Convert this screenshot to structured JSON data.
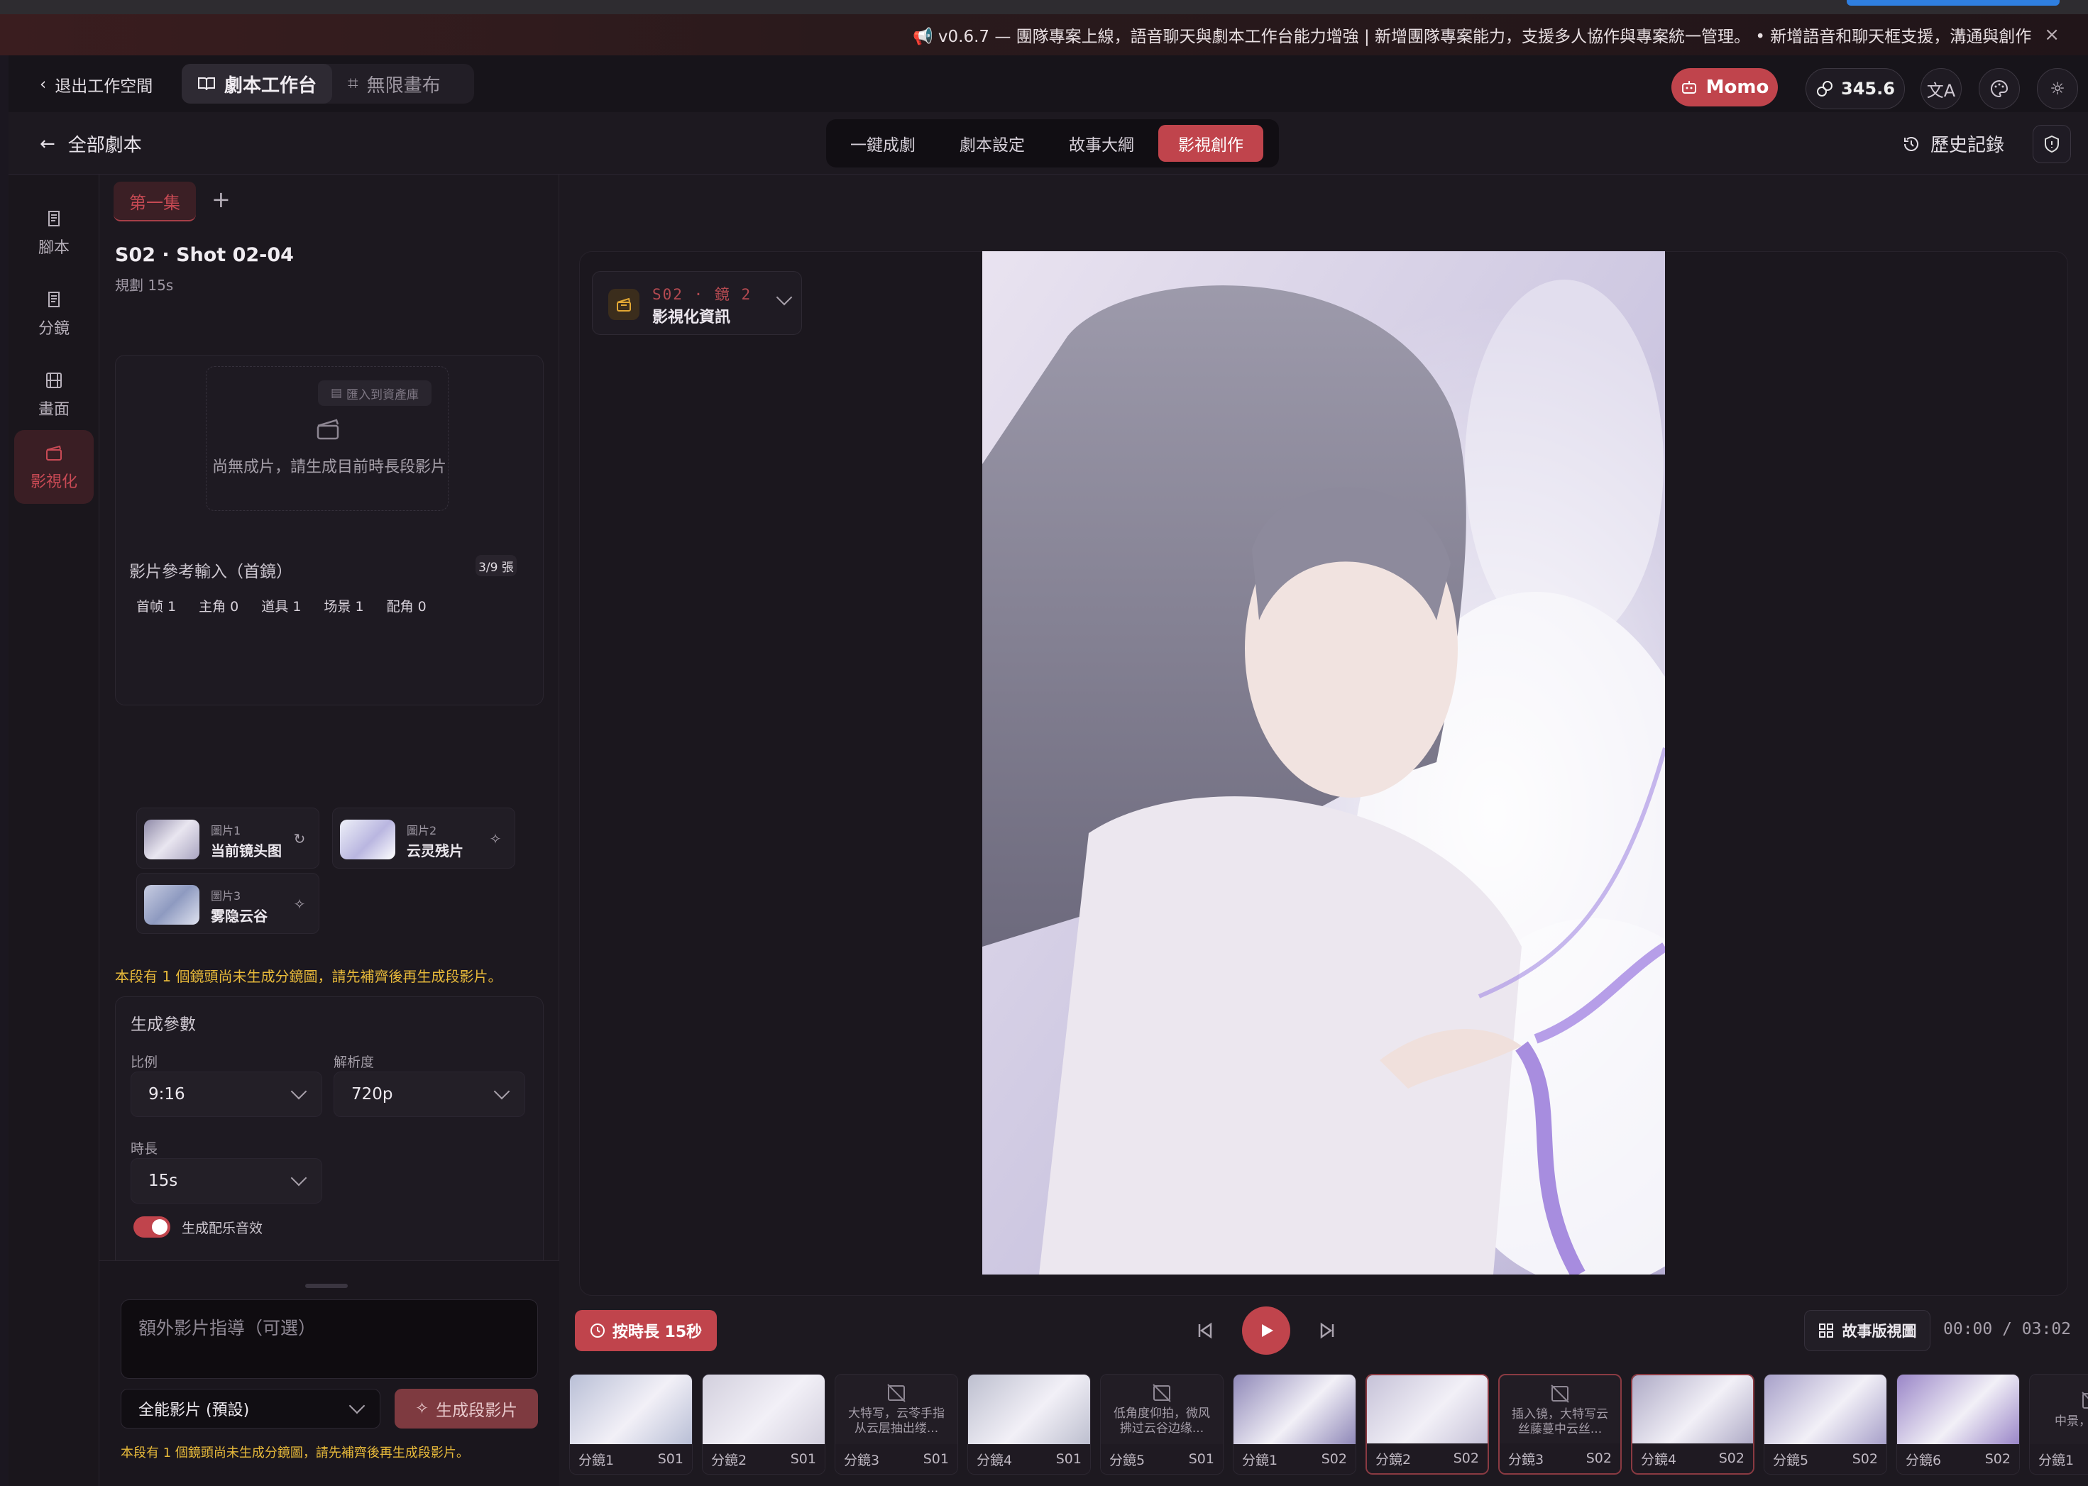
{
  "marquee": {
    "text": "📢 v0.6.7 — 團隊專案上線，語音聊天與劇本工作台能力增強 | 新增團隊專案能力，支援多人協作與專案統一管理。 • 新增語音和聊天框支援，溝通與創作",
    "close": "×"
  },
  "appbar": {
    "back": "退出工作空間",
    "tab_script": "劇本工作台",
    "tab_canvas": "無限畫布",
    "momo": "Momo",
    "credits": "345.6"
  },
  "subbar": {
    "back": "全部劇本",
    "modes": [
      "一鍵成劇",
      "劇本設定",
      "故事大綱",
      "影視創作"
    ],
    "active_mode": 3,
    "history": "歷史記錄"
  },
  "leftnav": {
    "items": [
      "腳本",
      "分鏡",
      "畫面",
      "影視化"
    ],
    "active": 3
  },
  "panel": {
    "episode": "第一集",
    "plus": "+",
    "shot_title": "S02 · Shot 02-04",
    "shot_plan": "規劃 15s",
    "import": "匯入到資產庫",
    "empty": "尚無成片，請生成目前時長段影片",
    "ref_title": "影片參考輸入（首鏡）",
    "ref_count": "3/9 張",
    "cats": [
      "首帧 1",
      "主角 0",
      "道具 1",
      "场景 1",
      "配角 0"
    ],
    "refs": [
      {
        "label": "圖片1",
        "name": "当前镜头图"
      },
      {
        "label": "圖片2",
        "name": "云灵残片"
      },
      {
        "label": "圖片3",
        "name": "雾隐云谷"
      }
    ],
    "warning": "本段有 1 個鏡頭尚未生成分鏡圖，請先補齊後再生成段影片。",
    "params_title": "生成參數",
    "ratio_label": "比例",
    "ratio": "9:16",
    "res_label": "解析度",
    "res": "720p",
    "dur_label": "時長",
    "dur": "15s",
    "music": "生成配乐音效",
    "music_on": true,
    "guide_placeholder": "額外影片指導（可選）",
    "model": "全能影片 (預設)",
    "gen": "生成段影片",
    "warning2": "本段有 1 個鏡頭尚未生成分鏡圖，請先補齊後再生成段影片。"
  },
  "main": {
    "shot_code": "S02 · 鏡 2",
    "shot_name": "影視化資訊",
    "dur_button": "按時長 15秒",
    "story_view": "故事版視圖",
    "timecode": "00:00 / 03:02"
  },
  "filmstrip": [
    {
      "label": "分鏡1",
      "scene": "S01",
      "type": "img",
      "tint": "#b9bfd6"
    },
    {
      "label": "分鏡2",
      "scene": "S01",
      "type": "img",
      "tint": "#d2cfdd"
    },
    {
      "label": "分鏡3",
      "scene": "S01",
      "type": "ph",
      "text": "大特写，云苓手指从云层抽出缕..."
    },
    {
      "label": "分鏡4",
      "scene": "S01",
      "type": "img",
      "tint": "#bdbfcf"
    },
    {
      "label": "分鏡5",
      "scene": "S01",
      "type": "ph",
      "text": "低角度仰拍，微风拂过云谷边缘..."
    },
    {
      "label": "分鏡1",
      "scene": "S02",
      "type": "img",
      "tint": "#8f88b8"
    },
    {
      "label": "分鏡2",
      "scene": "S02",
      "type": "img",
      "tint": "#c6c2d8",
      "sel": true
    },
    {
      "label": "分鏡3",
      "scene": "S02",
      "type": "ph",
      "text": "插入镜，大特写云丝藤蔓中云丝...",
      "sel": true
    },
    {
      "label": "分鏡4",
      "scene": "S02",
      "type": "img",
      "tint": "#aeaac6",
      "sel": true
    },
    {
      "label": "分鏡5",
      "scene": "S02",
      "type": "img",
      "tint": "#a7a0c9"
    },
    {
      "label": "分鏡6",
      "scene": "S02",
      "type": "img",
      "tint": "#9a86c8"
    },
    {
      "label": "分鏡1",
      "scene": "",
      "type": "ph",
      "text": "中景，來將旋"
    }
  ],
  "colors": {
    "accent": "#c0444c",
    "warning": "#e7b93a",
    "bg": "#1b1720"
  },
  "icons": [
    "chevron-left-icon",
    "book-icon",
    "grid-icon",
    "robot-icon",
    "link-icon",
    "translate-icon",
    "palette-icon",
    "sun-icon",
    "history-icon",
    "shield-icon",
    "clapper-icon",
    "sparkle-icon",
    "refresh-icon",
    "clock-icon",
    "skip-back-icon",
    "play-icon",
    "skip-forward-icon",
    "image-off-icon"
  ]
}
